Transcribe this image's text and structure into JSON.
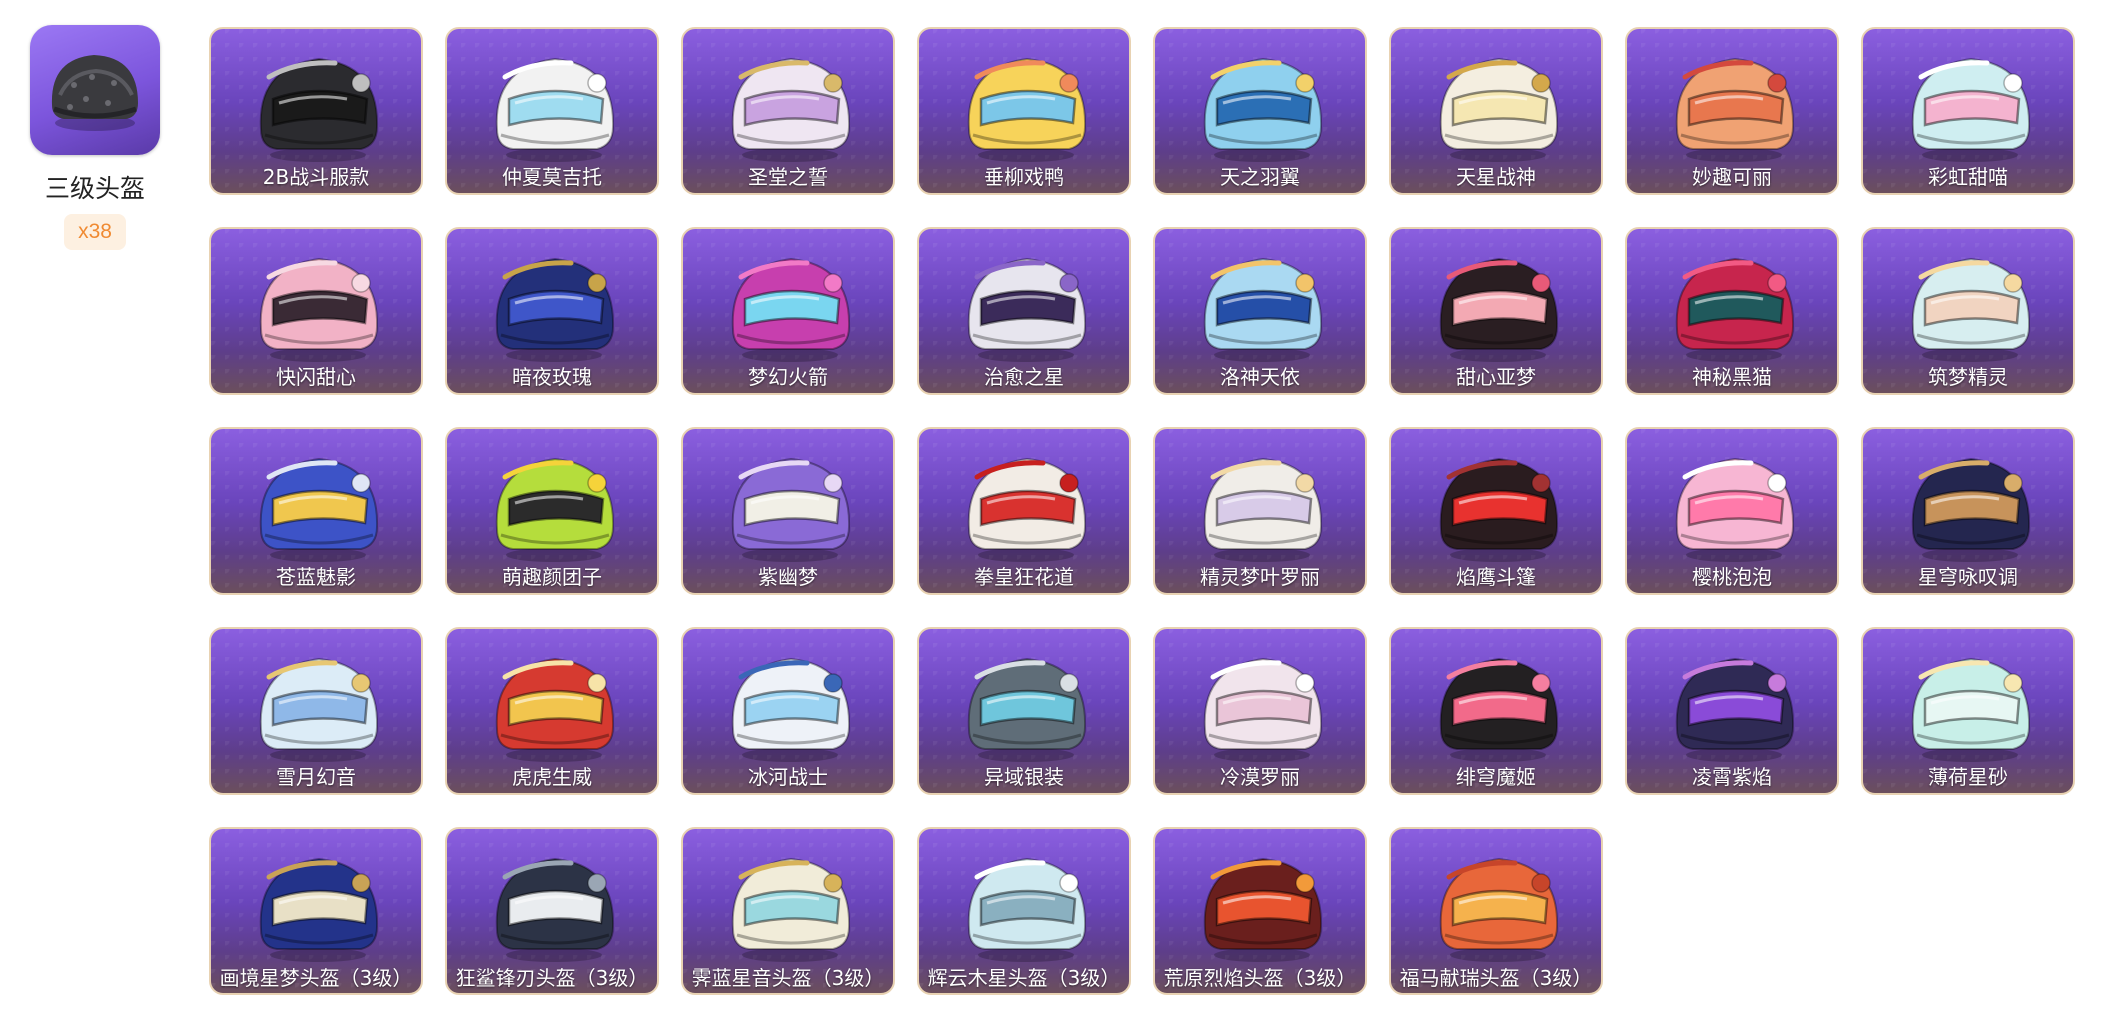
{
  "summary": {
    "item_name": "三级头盔",
    "count_label": "x38",
    "icon": "gray-helmet-icon"
  },
  "colors": {
    "card_bg_top": "#8b5fe0",
    "card_bg_bottom": "#6b4f5c",
    "card_border": "#e8d2b2",
    "count_badge_bg": "#fdf0e1",
    "count_badge_text": "#f08a32"
  },
  "skins": [
    {
      "name": "2B战斗服款",
      "shell": "#2b2b2f",
      "visor": "#1a1a1a",
      "accent": "#bfbfbf"
    },
    {
      "name": "仲夏莫吉托",
      "shell": "#f2f2f2",
      "visor": "#9fdcf0",
      "accent": "#ffffff"
    },
    {
      "name": "圣堂之誓",
      "shell": "#efe6f2",
      "visor": "#c9a3e0",
      "accent": "#d9b96a"
    },
    {
      "name": "垂柳戏鸭",
      "shell": "#f7d35a",
      "visor": "#7cc7e8",
      "accent": "#f08a5b"
    },
    {
      "name": "天之羽翼",
      "shell": "#8fd0ee",
      "visor": "#2b6fb5",
      "accent": "#f2d16a"
    },
    {
      "name": "天星战神",
      "shell": "#f4eee0",
      "visor": "#f5e7b2",
      "accent": "#d4a84b"
    },
    {
      "name": "妙趣可丽",
      "shell": "#f0a273",
      "visor": "#e8774e",
      "accent": "#d4493d"
    },
    {
      "name": "彩虹甜喵",
      "shell": "#cfeef1",
      "visor": "#f4b3cf",
      "accent": "#ffffff"
    },
    {
      "name": "快闪甜心",
      "shell": "#f2b2c6",
      "visor": "#3a2a35",
      "accent": "#f7d9e2"
    },
    {
      "name": "暗夜玫瑰",
      "shell": "#23307a",
      "visor": "#3f56c9",
      "accent": "#c8a449"
    },
    {
      "name": "梦幻火箭",
      "shell": "#c73fae",
      "visor": "#7ad6f0",
      "accent": "#f27ac7"
    },
    {
      "name": "治愈之星",
      "shell": "#e7e5ee",
      "visor": "#3b2b5a",
      "accent": "#8a66c8"
    },
    {
      "name": "洛神天依",
      "shell": "#aad9f2",
      "visor": "#254fa8",
      "accent": "#f2c46a"
    },
    {
      "name": "甜心亚梦",
      "shell": "#2a1e22",
      "visor": "#f3a9b3",
      "accent": "#e85a78"
    },
    {
      "name": "神秘黑猫",
      "shell": "#c7254d",
      "visor": "#20595c",
      "accent": "#f25a84"
    },
    {
      "name": "筑梦精灵",
      "shell": "#d7eef0",
      "visor": "#f1d4c1",
      "accent": "#f5d9a0"
    },
    {
      "name": "苍蓝魅影",
      "shell": "#3d53c7",
      "visor": "#f0c74e",
      "accent": "#dfe6f5"
    },
    {
      "name": "萌趣颜团子",
      "shell": "#b5dd3c",
      "visor": "#2b2b2b",
      "accent": "#f5d33a"
    },
    {
      "name": "紫幽梦",
      "shell": "#8a6ad6",
      "visor": "#f1efe6",
      "accent": "#e7d8f5"
    },
    {
      "name": "拳皇狂花道",
      "shell": "#f2ece5",
      "visor": "#d9322f",
      "accent": "#c7201f"
    },
    {
      "name": "精灵梦叶罗丽",
      "shell": "#f0ede8",
      "visor": "#d8cbe8",
      "accent": "#f2d9a6"
    },
    {
      "name": "焰鹰斗篷",
      "shell": "#2a1c1f",
      "visor": "#e8322f",
      "accent": "#a23232"
    },
    {
      "name": "樱桃泡泡",
      "shell": "#f7b6d3",
      "visor": "#ff7aaa",
      "accent": "#ffffff"
    },
    {
      "name": "星穹咏叹调",
      "shell": "#24264f",
      "visor": "#c7935b",
      "accent": "#d8ad6a"
    },
    {
      "name": "雪月幻音",
      "shell": "#dcecf7",
      "visor": "#8fb8e8",
      "accent": "#e7c773"
    },
    {
      "name": "虎虎生威",
      "shell": "#d63a30",
      "visor": "#f2c54e",
      "accent": "#f7e3a8"
    },
    {
      "name": "冰河战士",
      "shell": "#eef2f8",
      "visor": "#9bd3f2",
      "accent": "#3a67b7"
    },
    {
      "name": "异域银装",
      "shell": "#5f6d78",
      "visor": "#6fc6dc",
      "accent": "#d9dfe4"
    },
    {
      "name": "冷漠罗丽",
      "shell": "#f1e4ec",
      "visor": "#eac5d8",
      "accent": "#ffffff"
    },
    {
      "name": "绯穹魔姬",
      "shell": "#232022",
      "visor": "#f26a8a",
      "accent": "#f57fa0"
    },
    {
      "name": "凌霄紫焰",
      "shell": "#2f2a55",
      "visor": "#8a4bd8",
      "accent": "#c77bdc"
    },
    {
      "name": "薄荷星砂",
      "shell": "#c8efe8",
      "visor": "#e7f7f3",
      "accent": "#f7e7b1"
    },
    {
      "name": "画境星梦头盔（3级）",
      "shell": "#23338a",
      "visor": "#e8e0c6",
      "accent": "#c9a356"
    },
    {
      "name": "狂鲨锋刃头盔（3级）",
      "shell": "#2c3346",
      "visor": "#e9ecef",
      "accent": "#9aa6b4"
    },
    {
      "name": "霁蓝星音头盔（3级）",
      "shell": "#f1ecd9",
      "visor": "#9ad8df",
      "accent": "#d7b35a"
    },
    {
      "name": "辉云木星头盔（3级）",
      "shell": "#cfe9f0",
      "visor": "#8ab0c0",
      "accent": "#ffffff"
    },
    {
      "name": "荒原烈焰头盔（3级）",
      "shell": "#6a1f1d",
      "visor": "#e8542f",
      "accent": "#f29a3a"
    },
    {
      "name": "福马献瑞头盔（3级）",
      "shell": "#e8673a",
      "visor": "#f5b24d",
      "accent": "#c7452a"
    }
  ]
}
